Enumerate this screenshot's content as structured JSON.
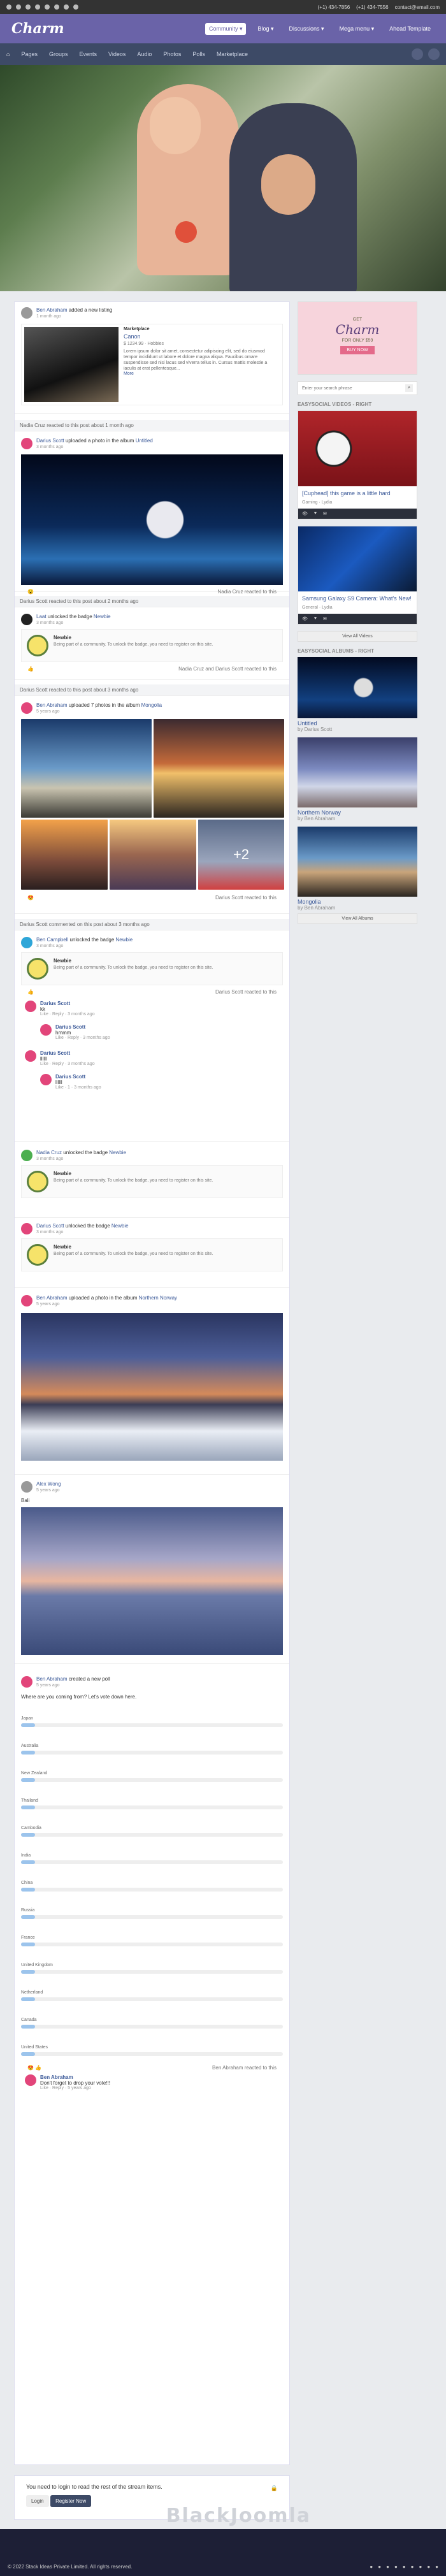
{
  "topbar": {
    "phone1": "(+1) 434-7856",
    "phone2": "(+1) 434-7556",
    "email": "contact@email.com"
  },
  "header": {
    "logo": "Charm",
    "nav": [
      "Community ▾",
      "Blog ▾",
      "Discussions ▾",
      "Mega menu ▾",
      "Ahead Template"
    ]
  },
  "subnav": [
    "Pages",
    "Groups",
    "Events",
    "Videos",
    "Audio",
    "Photos",
    "Polls",
    "Marketplace"
  ],
  "stream": {
    "i1": {
      "actor": "Ben Abraham",
      "verb": "added a new listing",
      "time": "1 month ago",
      "cat": "Marketplace",
      "title": "Canon",
      "price": "$ 1234.99 · Hobbies",
      "desc": "Lorem ipsum dolor sit amet, consectetur adipiscing elit, sed do eiusmod tempor incididunt ut labore et dolore magna aliqua. Faucibus ornare suspendisse sed nisi lacus sed viverra tellus in. Cursus mattis molestie a iaculis at erat pellentesque...",
      "more": "More"
    },
    "i2": {
      "reactby": "Nadia Cruz reacted to this post about 1 month ago",
      "actor": "Darius Scott",
      "verb": "uploaded a photo in the album",
      "album": "Untitled",
      "time": "3 months ago",
      "reacted": "Nadia Cruz reacted to this"
    },
    "i3": {
      "reactby": "Darius Scott reacted to this post about 2 months ago",
      "actor": "Laat",
      "verb": "unlocked the badge",
      "badge": "Newbie",
      "time": "3 months ago",
      "btitle": "Newbie",
      "bdesc": "Being part of a community. To unlock the badge, you need to register on this site.",
      "reacted": "Nadia Cruz and Darius Scott reacted to this"
    },
    "i4": {
      "reactby": "Darius Scott reacted to this post about 3 months ago",
      "actor": "Ben Abraham",
      "verb": "uploaded 7 photos in the album",
      "album": "Mongolia",
      "time": "5 years ago",
      "more": "+2",
      "reacted": "Darius Scott reacted to this"
    },
    "i5": {
      "reactby": "Darius Scott commented on this post about 3 months ago",
      "actor": "Ben Campbell",
      "verb": "unlocked the badge",
      "badge": "Newbie",
      "time": "3 months ago",
      "btitle": "Newbie",
      "bdesc": "Being part of a community. To unlock the badge, you need to register on this site.",
      "reacted": "Darius Scott reacted to this",
      "c1": {
        "name": "Darius Scott",
        "text": "kk",
        "meta": "Like · Reply · 3 months ago"
      },
      "c2": {
        "name": "Darius Scott",
        "text": "hmmm",
        "meta": "Like · Reply · 3 months ago"
      },
      "c3": {
        "name": "Darius Scott",
        "text": "llllll",
        "meta": "Like · Reply · 3 months ago"
      },
      "c4": {
        "name": "Darius Scott",
        "text": "llllll",
        "meta": "Like · 1 · 3 months ago"
      }
    },
    "i6": {
      "actor": "Nadia Cruz",
      "verb": "unlocked the badge",
      "badge": "Newbie",
      "time": "3 months ago",
      "btitle": "Newbie",
      "bdesc": "Being part of a community. To unlock the badge, you need to register on this site."
    },
    "i7": {
      "actor": "Darius Scott",
      "verb": "unlocked the badge",
      "badge": "Newbie",
      "time": "3 months ago",
      "btitle": "Newbie",
      "bdesc": "Being part of a community. To unlock the badge, you need to register on this site."
    },
    "i8": {
      "actor": "Ben Abraham",
      "verb": "uploaded a photo in the album",
      "album": "Northern Norway",
      "time": "5 years ago"
    },
    "i9": {
      "actor": "Alex Wong",
      "time": "5 years ago",
      "text": "Bali"
    },
    "i10": {
      "actor": "Ben Abraham",
      "verb": "created a new poll",
      "time": "5 years ago",
      "question": "Where are you coming from? Let's vote down here.",
      "options": [
        "Japan",
        "Australia",
        "New Zealand",
        "Thailand",
        "Cambodia",
        "India",
        "China",
        "Russia",
        "France",
        "United Kingdom",
        "Netherland",
        "Canada",
        "United States"
      ],
      "reacted": "Ben Abraham reacted to this",
      "c1": {
        "name": "Ben Abraham",
        "text": "Don't forget to drop your vote!!!",
        "meta": "Like · Reply · 5 years ago"
      }
    }
  },
  "login": {
    "text": "You need to login to read the rest of the stream items.",
    "login": "Login",
    "register": "Register Now"
  },
  "side": {
    "ad": {
      "get": "GET",
      "logo": "Charm",
      "price": "FOR ONLY $59",
      "buy": "BUY NOW"
    },
    "search": "Enter your search phrase",
    "vt": "EASYSOCIAL VIDEOS - RIGHT",
    "v1": {
      "title": "[Cuphead] this game is a little hard",
      "cat": "Gaming",
      "author": "Lydia"
    },
    "v2": {
      "title": "Samsung Galaxy S9 Camera: What's New!",
      "cat": "General",
      "author": "Lydia"
    },
    "vall": "View All Videos",
    "at": "EASYSOCIAL ALBUMS - RIGHT",
    "a1": {
      "title": "Untitled",
      "by": "by Darius Scott"
    },
    "a2": {
      "title": "Northern Norway",
      "by": "by Ben Abraham"
    },
    "a3": {
      "title": "Mongolia",
      "by": "by Ben Abraham"
    },
    "aall": "View All Albums"
  },
  "footer": {
    "copy": "© 2022 Stack Ideas Private Limited. All rights reserved."
  },
  "watermark": "BlackJoomla"
}
